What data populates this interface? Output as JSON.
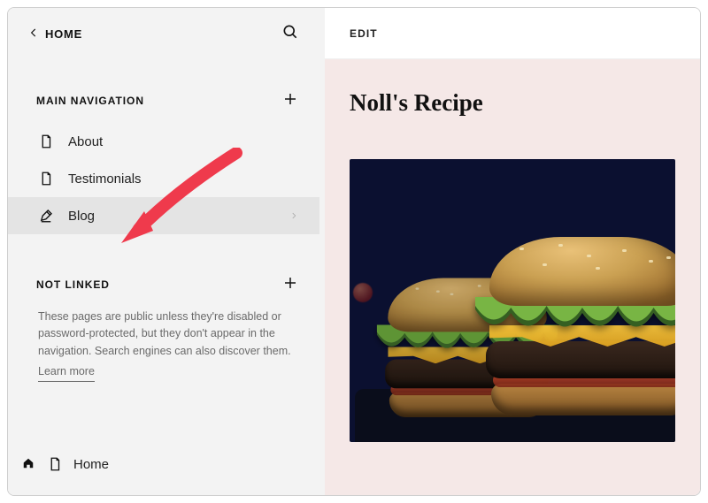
{
  "header": {
    "breadcrumb": "HOME"
  },
  "sections": {
    "main_nav_label": "MAIN NAVIGATION",
    "not_linked_label": "NOT LINKED",
    "not_linked_desc": "These pages are public unless they're disabled or password-protected, but they don't appear in the navigation. Search engines can also discover them.",
    "learn_more": "Learn more"
  },
  "nav": {
    "items": [
      {
        "label": "About"
      },
      {
        "label": "Testimonials"
      },
      {
        "label": "Blog"
      }
    ]
  },
  "home_row": {
    "label": "Home"
  },
  "preview": {
    "edit_label": "EDIT",
    "page_title": "Noll's Recipe"
  }
}
